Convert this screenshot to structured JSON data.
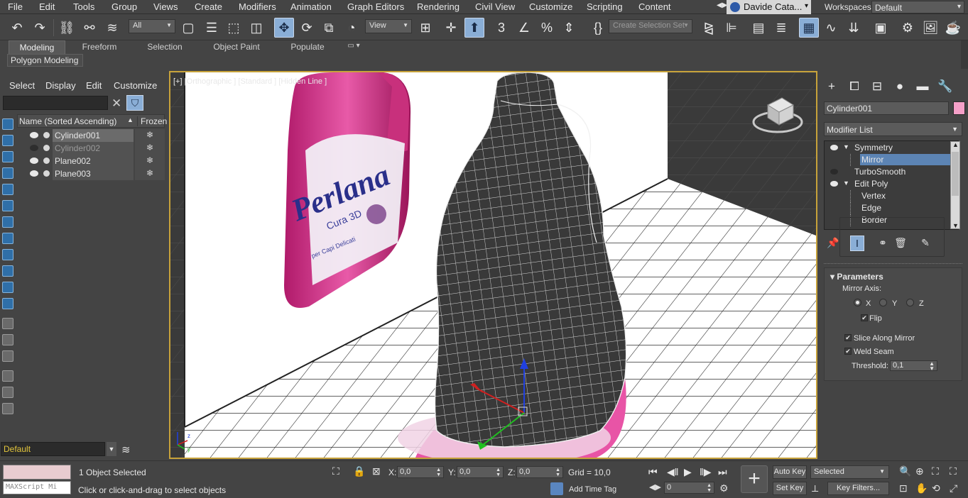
{
  "menu": [
    "File",
    "Edit",
    "Tools",
    "Group",
    "Views",
    "Create",
    "Modifiers",
    "Animation",
    "Graph Editors",
    "Rendering",
    "Civil View",
    "Customize",
    "Scripting",
    "Content"
  ],
  "user": "Davide Cata...",
  "workspaces": {
    "label": "Workspaces:",
    "value": "Default"
  },
  "toolbar": {
    "selection_filter": "All",
    "ref_coord": "View",
    "named_selection_placeholder": "Create Selection Set"
  },
  "ribbon": {
    "tabs": [
      "Modeling",
      "Freeform",
      "Selection",
      "Object Paint",
      "Populate"
    ],
    "active": "Modeling",
    "sub_label": "Polygon Modeling"
  },
  "explorer": {
    "menu": [
      "Select",
      "Display",
      "Edit",
      "Customize"
    ],
    "header_name": "Name (Sorted Ascending)",
    "header_sort": "▲",
    "header_frozen": "Frozen",
    "rows": [
      {
        "name": "Cylinder001",
        "visible": true,
        "selected": true
      },
      {
        "name": "Cylinder002",
        "visible": false,
        "selected": false
      },
      {
        "name": "Plane002",
        "visible": true,
        "selected": false
      },
      {
        "name": "Plane003",
        "visible": true,
        "selected": false
      }
    ],
    "frozen_glyph": "❄",
    "layer": "Default"
  },
  "viewport": {
    "label": "[+] [Orthographic ] [Standard ] [Hidden Line ]",
    "bottle_label": "Perlana",
    "bottle_sublabel": "Cura 3D",
    "bottle_small": "per Capi Delicati"
  },
  "command_panel": {
    "object_name": "Cylinder001",
    "object_color": "#f5a0c8",
    "modifier_list": "Modifier List",
    "stack": [
      {
        "label": "Symmetry",
        "level": 0,
        "eye": true,
        "expanded": true
      },
      {
        "label": "Mirror",
        "level": 1,
        "selected": true
      },
      {
        "label": "TurboSmooth",
        "level": 0,
        "eye": false
      },
      {
        "label": "Edit Poly",
        "level": 0,
        "eye": true,
        "expanded": true
      },
      {
        "label": "Vertex",
        "level": 1
      },
      {
        "label": "Edge",
        "level": 1
      },
      {
        "label": "Border",
        "level": 1
      }
    ],
    "parameters": {
      "title": "Parameters",
      "mirror_axis_label": "Mirror Axis:",
      "axes": [
        "X",
        "Y",
        "Z"
      ],
      "axis_selected": "X",
      "flip_label": "Flip",
      "flip": true,
      "slice_label": "Slice Along Mirror",
      "slice": true,
      "weld_label": "Weld Seam",
      "weld": true,
      "threshold_label": "Threshold:",
      "threshold": "0,1"
    }
  },
  "status": {
    "maxscript": "MAXScript Mi",
    "selected": "1 Object Selected",
    "prompt": "Click or click-and-drag to select objects",
    "x_label": "X:",
    "x": "0,0",
    "y_label": "Y:",
    "y": "0,0",
    "z_label": "Z:",
    "z": "0,0",
    "grid": "Grid = 10,0",
    "add_time_tag": "Add Time Tag",
    "frame": "0",
    "auto_key": "Auto Key",
    "set_key": "Set Key",
    "selected_set": "Selected",
    "key_filters": "Key Filters..."
  }
}
